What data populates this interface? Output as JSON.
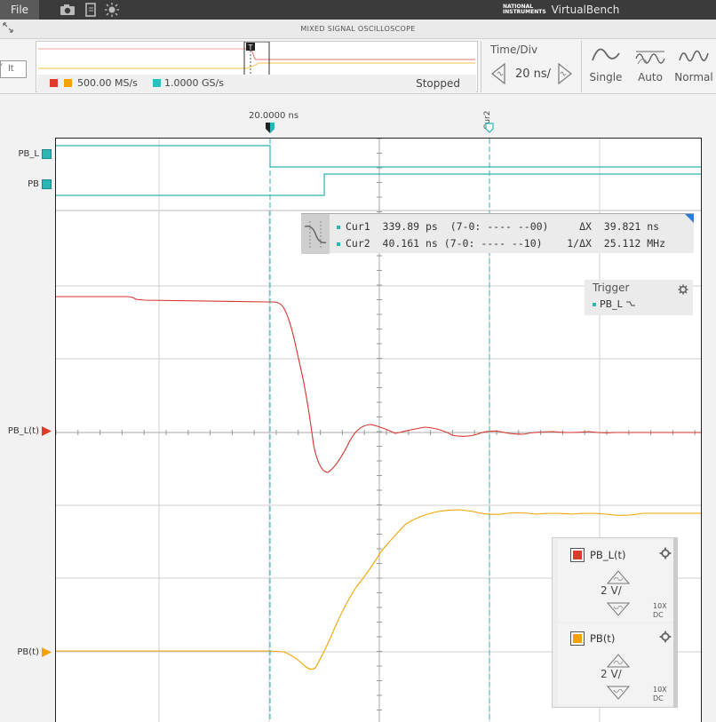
{
  "menu": {
    "file_label": "File"
  },
  "brand": {
    "logo_line1": "NATIONAL",
    "logo_line2": "INSTRUMENTS",
    "product": "VirtualBench"
  },
  "instrument_title": "MIXED SIGNAL OSCILLOSCOPE",
  "left_tab_label": "lt",
  "overview": {
    "analog_rate": "500.00 MS/s",
    "digital_rate": "1.0000 GS/s",
    "status": "Stopped",
    "colors": {
      "ch1": "#e03a2a",
      "ch2": "#f5a200",
      "digital": "#2bc0c0"
    }
  },
  "time_div": {
    "label": "Time/Div",
    "value": "20 ns/"
  },
  "modes": [
    {
      "label": "Single"
    },
    {
      "label": "Auto"
    },
    {
      "label": "Normal"
    }
  ],
  "trigger_time": "20.0000 ns",
  "cursor_flags": {
    "cur2": "Cur2"
  },
  "channel_labels": {
    "pb_l": "PB_L",
    "pb": "PB",
    "pb_l_t": "PB_L(t)",
    "pb_t": "PB(t)"
  },
  "cursor_readout": {
    "row1": "Cur1  339.89 ps  (7-0: ---- --00)     ΔX  39.821 ns",
    "row2": "Cur2  40.161 ns (7-0: ---- --10)    1/ΔX  25.112 MHz"
  },
  "trigger_panel": {
    "title": "Trigger",
    "source": "PB_L"
  },
  "channels": [
    {
      "name": "PB_L(t)",
      "scale": "2 V/",
      "probe": "10X",
      "coupling": "DC",
      "color": "#e03a2a"
    },
    {
      "name": "PB(t)",
      "scale": "2 V/",
      "probe": "10X",
      "coupling": "DC",
      "color": "#f5a200"
    }
  ],
  "colors": {
    "trace_pb_l_t": "#d8322a",
    "trace_pb_t": "#f0a400",
    "digital": "#2bb5b5",
    "grid": "#c8c8c8"
  }
}
